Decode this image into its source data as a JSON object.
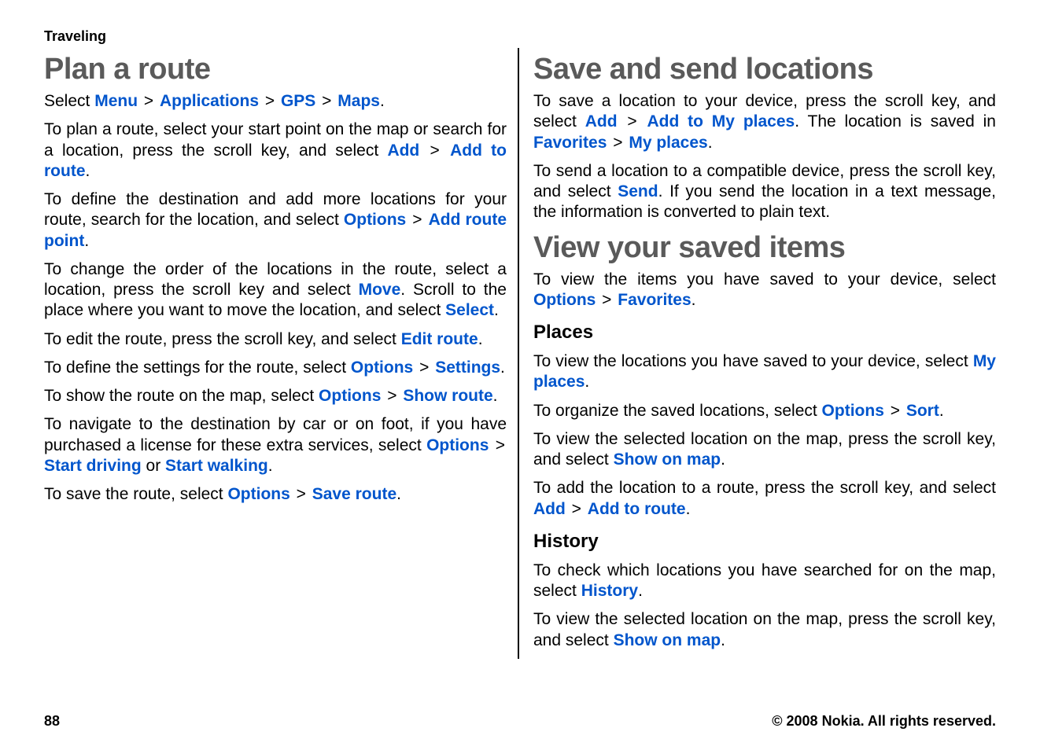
{
  "breadcrumb": "Traveling",
  "sep": ">",
  "footer": {
    "page": "88",
    "copyright": "© 2008 Nokia. All rights reserved."
  },
  "left": {
    "h1": "Plan a route",
    "p1": {
      "t1": "Select ",
      "menu": "Menu",
      "apps": "Applications",
      "gps": "GPS",
      "maps": "Maps",
      "end": "."
    },
    "p2": {
      "t1": "To plan a route, select your start point on the map or search for a location, press the scroll key, and select ",
      "add": "Add",
      "addToRoute": "Add to route",
      "end": "."
    },
    "p3": {
      "t1": "To define the destination and add more locations for your route, search for the location, and select ",
      "options": "Options",
      "addRoutePoint": "Add route point",
      "end": "."
    },
    "p4": {
      "t1": "To change the order of the locations in the route, select a location, press the scroll key and select ",
      "move": "Move",
      "t2": ". Scroll to the place where you want to move the location, and select ",
      "select": "Select",
      "end": "."
    },
    "p5": {
      "t1": "To edit the route, press the scroll key, and select ",
      "editRoute": "Edit route",
      "end": "."
    },
    "p6": {
      "t1": "To define the settings for the route, select ",
      "options": "Options",
      "settings": "Settings",
      "end": "."
    },
    "p7": {
      "t1": "To show the route on the map, select ",
      "options": "Options",
      "showRoute": "Show route",
      "end": "."
    },
    "p8": {
      "t1": "To navigate to the destination by car or on foot, if you have purchased a license for these extra services, select ",
      "options": "Options",
      "startDriving": "Start driving",
      "or": " or ",
      "startWalking": "Start walking",
      "end": "."
    },
    "p9": {
      "t1": "To save the route, select ",
      "options": "Options",
      "saveRoute": "Save route",
      "end": "."
    }
  },
  "right": {
    "h1a": "Save and send locations",
    "p1": {
      "t1": "To save a location to your device, press the scroll key, and select ",
      "add": "Add",
      "addToMyPlaces": "Add to My places",
      "t2": ". The location is saved in ",
      "favorites": "Favorites",
      "myPlaces": "My places",
      "end": "."
    },
    "p2": {
      "t1": "To send a location to a compatible device, press the scroll key, and select ",
      "send": "Send",
      "t2": ". If you send the location in a text message, the information is converted to plain text."
    },
    "h1b": "View your saved items",
    "p3": {
      "t1": "To view the items you have saved to your device, select ",
      "options": "Options",
      "favorites": "Favorites",
      "end": "."
    },
    "h2a": "Places",
    "p4": {
      "t1": "To view the locations you have saved to your device, select ",
      "myPlaces": "My places",
      "end": "."
    },
    "p5": {
      "t1": "To organize the saved locations, select ",
      "options": "Options",
      "sort": "Sort",
      "end": "."
    },
    "p6": {
      "t1": "To view the selected location on the map, press the scroll key, and select ",
      "showOnMap": "Show on map",
      "end": "."
    },
    "p7": {
      "t1": "To add the location to a route, press the scroll key, and select ",
      "add": "Add",
      "addToRoute": "Add to route",
      "end": "."
    },
    "h2b": "History",
    "p8": {
      "t1": "To check which locations you have searched for on the map, select ",
      "history": "History",
      "end": "."
    },
    "p9": {
      "t1": "To view the selected location on the map, press the scroll key, and select ",
      "showOnMap": "Show on map",
      "end": "."
    }
  }
}
